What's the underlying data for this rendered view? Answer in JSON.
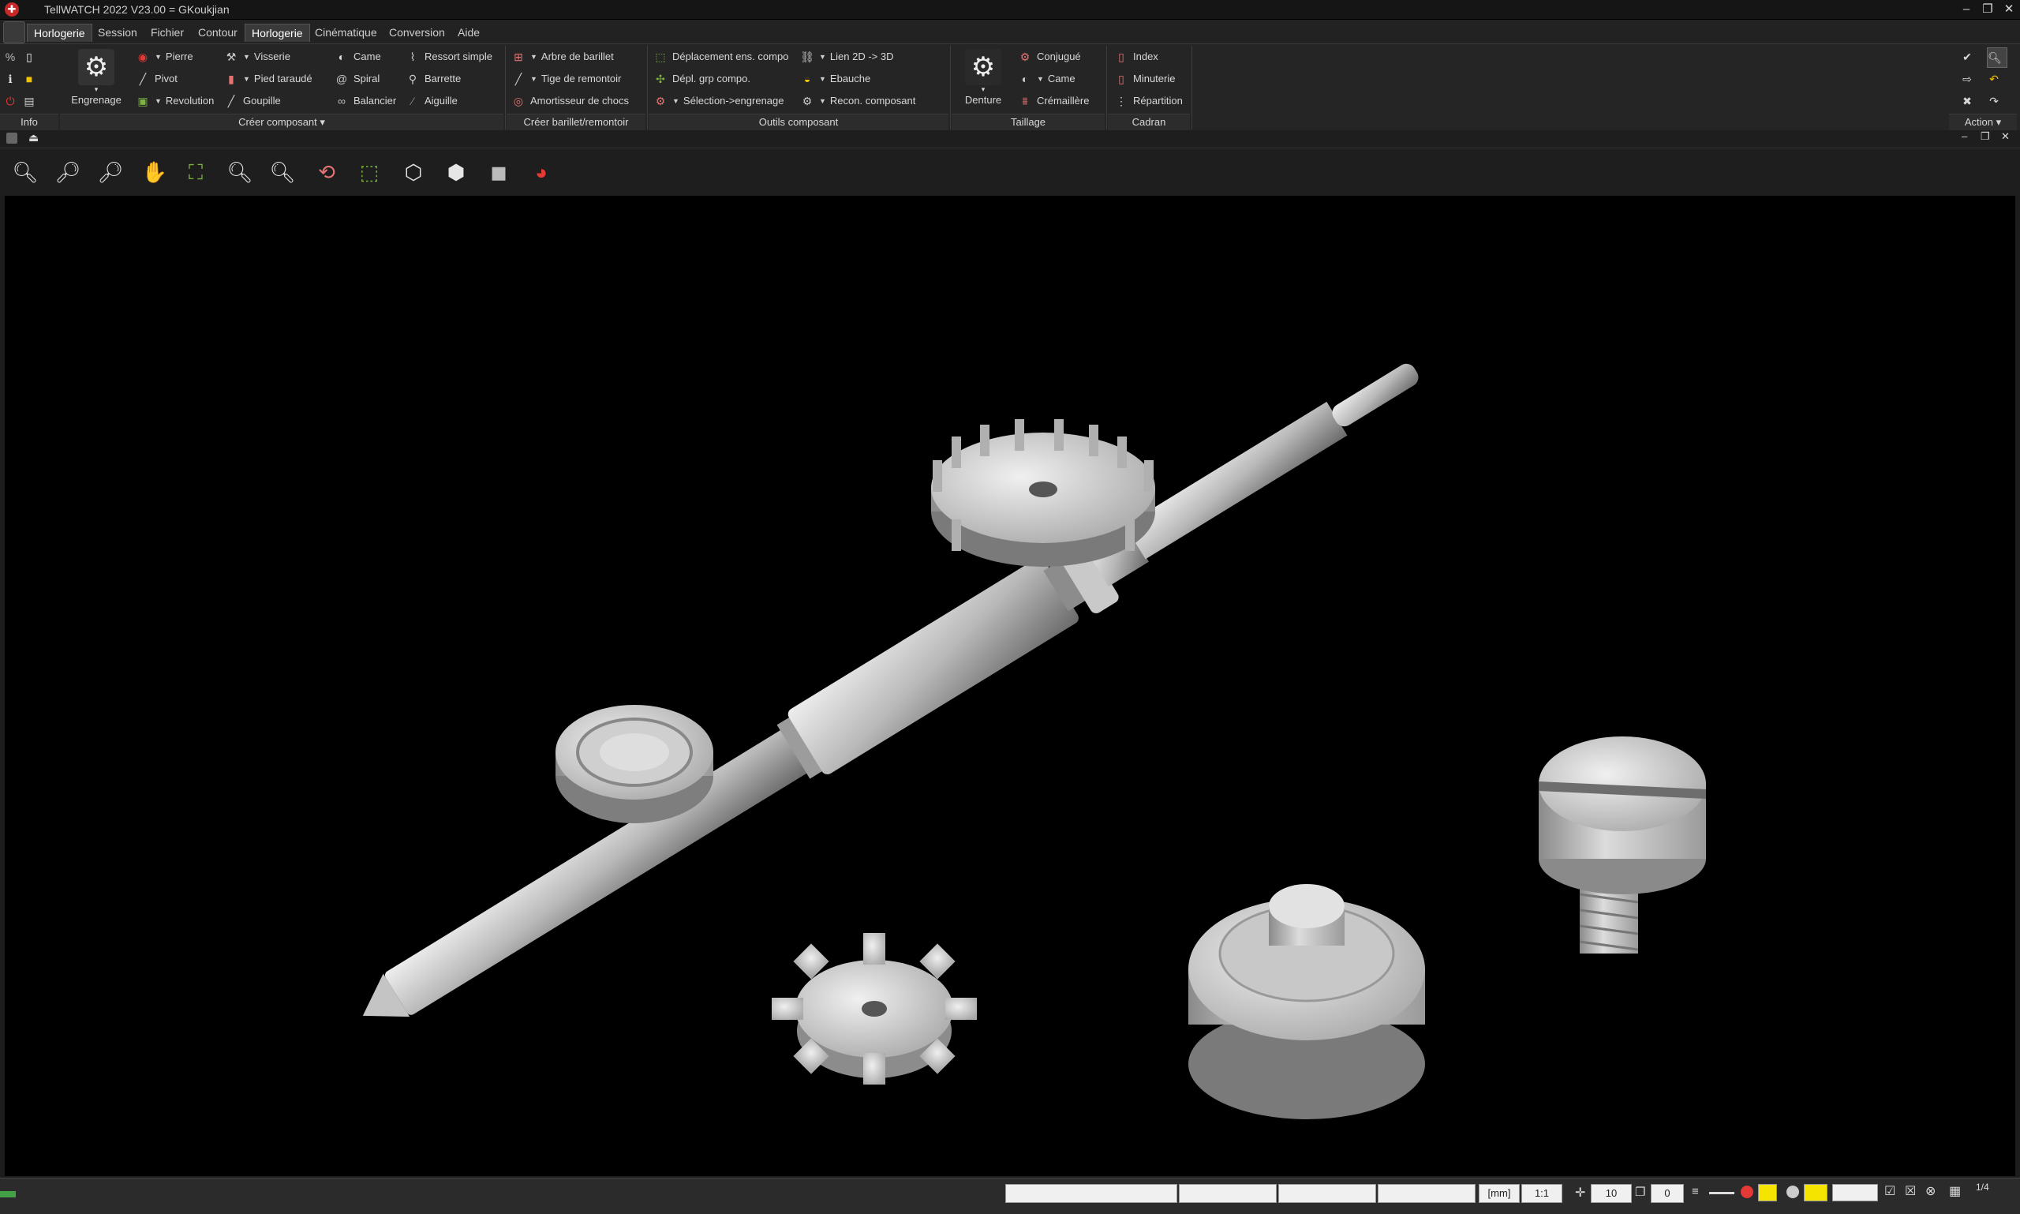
{
  "window": {
    "title": "TellWATCH 2022 V23.00 = GKoukjian",
    "buttons": [
      "–",
      "❐",
      "✕"
    ]
  },
  "menu": [
    "Horlogerie",
    "Session",
    "Fichier",
    "Contour",
    "Horlogerie",
    "Cinématique",
    "Conversion",
    "Aide"
  ],
  "ribbon": {
    "big_engrenage": "Engrenage",
    "creer": {
      "pierre": "Pierre",
      "pivot": "Pivot",
      "revolution": "Revolution",
      "visserie": "Visserie",
      "pied_taraude": "Pied taraudé",
      "goupille": "Goupille",
      "came": "Came",
      "spiral": "Spiral",
      "balancier": "Balancier",
      "ressort": "Ressort simple",
      "barrette": "Barrette",
      "aiguille": "Aiguille"
    },
    "barillet": {
      "arbre": "Arbre de barillet",
      "tige": "Tige de remontoir",
      "amortisseur": "Amortisseur de chocs"
    },
    "outils": {
      "deplacement": "Déplacement ens. compo",
      "depl_grp": "Dépl. grp compo.",
      "selection": "Sélection->engrenage",
      "lien": "Lien 2D -> 3D",
      "ebauche": "Ebauche",
      "recon": "Recon. composant"
    },
    "taillage": {
      "denture": "Denture",
      "conjugue": "Conjugué",
      "came": "Came",
      "cremaillere": "Crémaillère"
    },
    "cadran": {
      "index": "Index",
      "minuterie": "Minuterie",
      "repartition": "Répartition"
    },
    "groups": {
      "info": "Info",
      "creer": "Créer composant ▾",
      "barillet": "Créer barillet/remontoir",
      "outils": "Outils composant",
      "taillage": "Taillage",
      "cadran": "Cadran",
      "action": "Action ▾"
    }
  },
  "status": {
    "unit": "[mm]",
    "scale": "1:1",
    "grid": "10",
    "layer": "0",
    "pages": "1/4"
  },
  "colors": {
    "accent_red": "#c62828",
    "background": "#000000",
    "part": "#c8c8c8"
  }
}
